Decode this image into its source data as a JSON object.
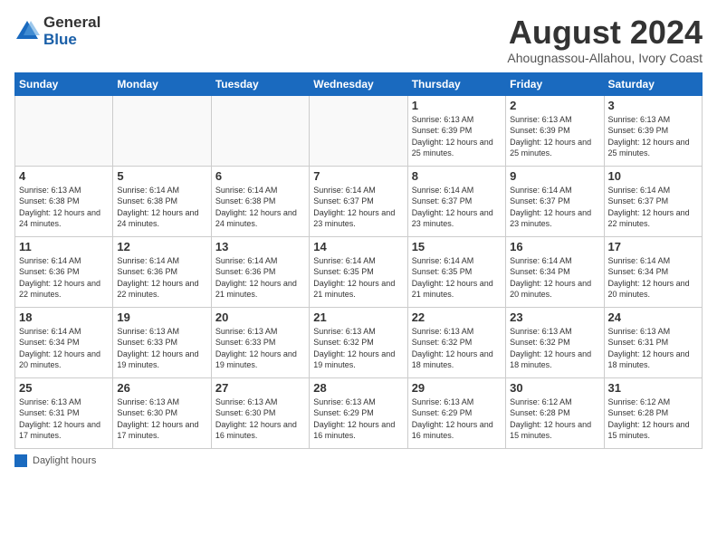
{
  "logo": {
    "general": "General",
    "blue": "Blue"
  },
  "title": {
    "month_year": "August 2024",
    "location": "Ahougnassou-Allahou, Ivory Coast"
  },
  "headers": [
    "Sunday",
    "Monday",
    "Tuesday",
    "Wednesday",
    "Thursday",
    "Friday",
    "Saturday"
  ],
  "legend": {
    "label": "Daylight hours"
  },
  "weeks": [
    [
      {
        "day": "",
        "sunrise": "",
        "sunset": "",
        "daylight": ""
      },
      {
        "day": "",
        "sunrise": "",
        "sunset": "",
        "daylight": ""
      },
      {
        "day": "",
        "sunrise": "",
        "sunset": "",
        "daylight": ""
      },
      {
        "day": "",
        "sunrise": "",
        "sunset": "",
        "daylight": ""
      },
      {
        "day": "1",
        "sunrise": "Sunrise: 6:13 AM",
        "sunset": "Sunset: 6:39 PM",
        "daylight": "Daylight: 12 hours and 25 minutes."
      },
      {
        "day": "2",
        "sunrise": "Sunrise: 6:13 AM",
        "sunset": "Sunset: 6:39 PM",
        "daylight": "Daylight: 12 hours and 25 minutes."
      },
      {
        "day": "3",
        "sunrise": "Sunrise: 6:13 AM",
        "sunset": "Sunset: 6:39 PM",
        "daylight": "Daylight: 12 hours and 25 minutes."
      }
    ],
    [
      {
        "day": "4",
        "sunrise": "Sunrise: 6:13 AM",
        "sunset": "Sunset: 6:38 PM",
        "daylight": "Daylight: 12 hours and 24 minutes."
      },
      {
        "day": "5",
        "sunrise": "Sunrise: 6:14 AM",
        "sunset": "Sunset: 6:38 PM",
        "daylight": "Daylight: 12 hours and 24 minutes."
      },
      {
        "day": "6",
        "sunrise": "Sunrise: 6:14 AM",
        "sunset": "Sunset: 6:38 PM",
        "daylight": "Daylight: 12 hours and 24 minutes."
      },
      {
        "day": "7",
        "sunrise": "Sunrise: 6:14 AM",
        "sunset": "Sunset: 6:37 PM",
        "daylight": "Daylight: 12 hours and 23 minutes."
      },
      {
        "day": "8",
        "sunrise": "Sunrise: 6:14 AM",
        "sunset": "Sunset: 6:37 PM",
        "daylight": "Daylight: 12 hours and 23 minutes."
      },
      {
        "day": "9",
        "sunrise": "Sunrise: 6:14 AM",
        "sunset": "Sunset: 6:37 PM",
        "daylight": "Daylight: 12 hours and 23 minutes."
      },
      {
        "day": "10",
        "sunrise": "Sunrise: 6:14 AM",
        "sunset": "Sunset: 6:37 PM",
        "daylight": "Daylight: 12 hours and 22 minutes."
      }
    ],
    [
      {
        "day": "11",
        "sunrise": "Sunrise: 6:14 AM",
        "sunset": "Sunset: 6:36 PM",
        "daylight": "Daylight: 12 hours and 22 minutes."
      },
      {
        "day": "12",
        "sunrise": "Sunrise: 6:14 AM",
        "sunset": "Sunset: 6:36 PM",
        "daylight": "Daylight: 12 hours and 22 minutes."
      },
      {
        "day": "13",
        "sunrise": "Sunrise: 6:14 AM",
        "sunset": "Sunset: 6:36 PM",
        "daylight": "Daylight: 12 hours and 21 minutes."
      },
      {
        "day": "14",
        "sunrise": "Sunrise: 6:14 AM",
        "sunset": "Sunset: 6:35 PM",
        "daylight": "Daylight: 12 hours and 21 minutes."
      },
      {
        "day": "15",
        "sunrise": "Sunrise: 6:14 AM",
        "sunset": "Sunset: 6:35 PM",
        "daylight": "Daylight: 12 hours and 21 minutes."
      },
      {
        "day": "16",
        "sunrise": "Sunrise: 6:14 AM",
        "sunset": "Sunset: 6:34 PM",
        "daylight": "Daylight: 12 hours and 20 minutes."
      },
      {
        "day": "17",
        "sunrise": "Sunrise: 6:14 AM",
        "sunset": "Sunset: 6:34 PM",
        "daylight": "Daylight: 12 hours and 20 minutes."
      }
    ],
    [
      {
        "day": "18",
        "sunrise": "Sunrise: 6:14 AM",
        "sunset": "Sunset: 6:34 PM",
        "daylight": "Daylight: 12 hours and 20 minutes."
      },
      {
        "day": "19",
        "sunrise": "Sunrise: 6:13 AM",
        "sunset": "Sunset: 6:33 PM",
        "daylight": "Daylight: 12 hours and 19 minutes."
      },
      {
        "day": "20",
        "sunrise": "Sunrise: 6:13 AM",
        "sunset": "Sunset: 6:33 PM",
        "daylight": "Daylight: 12 hours and 19 minutes."
      },
      {
        "day": "21",
        "sunrise": "Sunrise: 6:13 AM",
        "sunset": "Sunset: 6:32 PM",
        "daylight": "Daylight: 12 hours and 19 minutes."
      },
      {
        "day": "22",
        "sunrise": "Sunrise: 6:13 AM",
        "sunset": "Sunset: 6:32 PM",
        "daylight": "Daylight: 12 hours and 18 minutes."
      },
      {
        "day": "23",
        "sunrise": "Sunrise: 6:13 AM",
        "sunset": "Sunset: 6:32 PM",
        "daylight": "Daylight: 12 hours and 18 minutes."
      },
      {
        "day": "24",
        "sunrise": "Sunrise: 6:13 AM",
        "sunset": "Sunset: 6:31 PM",
        "daylight": "Daylight: 12 hours and 18 minutes."
      }
    ],
    [
      {
        "day": "25",
        "sunrise": "Sunrise: 6:13 AM",
        "sunset": "Sunset: 6:31 PM",
        "daylight": "Daylight: 12 hours and 17 minutes."
      },
      {
        "day": "26",
        "sunrise": "Sunrise: 6:13 AM",
        "sunset": "Sunset: 6:30 PM",
        "daylight": "Daylight: 12 hours and 17 minutes."
      },
      {
        "day": "27",
        "sunrise": "Sunrise: 6:13 AM",
        "sunset": "Sunset: 6:30 PM",
        "daylight": "Daylight: 12 hours and 16 minutes."
      },
      {
        "day": "28",
        "sunrise": "Sunrise: 6:13 AM",
        "sunset": "Sunset: 6:29 PM",
        "daylight": "Daylight: 12 hours and 16 minutes."
      },
      {
        "day": "29",
        "sunrise": "Sunrise: 6:13 AM",
        "sunset": "Sunset: 6:29 PM",
        "daylight": "Daylight: 12 hours and 16 minutes."
      },
      {
        "day": "30",
        "sunrise": "Sunrise: 6:12 AM",
        "sunset": "Sunset: 6:28 PM",
        "daylight": "Daylight: 12 hours and 15 minutes."
      },
      {
        "day": "31",
        "sunrise": "Sunrise: 6:12 AM",
        "sunset": "Sunset: 6:28 PM",
        "daylight": "Daylight: 12 hours and 15 minutes."
      }
    ]
  ]
}
